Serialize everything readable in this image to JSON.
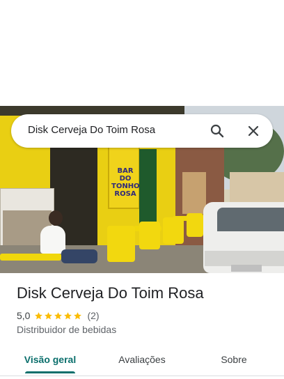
{
  "search": {
    "query": "Disk Cerveja Do Toim Rosa"
  },
  "photo": {
    "sign_text": "BAR DO TONHO ROSA"
  },
  "place": {
    "name": "Disk Cerveja Do Toim Rosa",
    "rating": "5,0",
    "stars_filled": 5,
    "stars_total": 5,
    "review_count": "(2)",
    "category": "Distribuidor de bebidas"
  },
  "tabs": [
    {
      "label": "Visão geral",
      "active": true
    },
    {
      "label": "Avaliações",
      "active": false
    },
    {
      "label": "Sobre",
      "active": false
    }
  ],
  "colors": {
    "accent": "#0b6f6c",
    "star": "#fbbc04"
  },
  "icons": {
    "search": "search-icon",
    "close": "close-icon"
  }
}
